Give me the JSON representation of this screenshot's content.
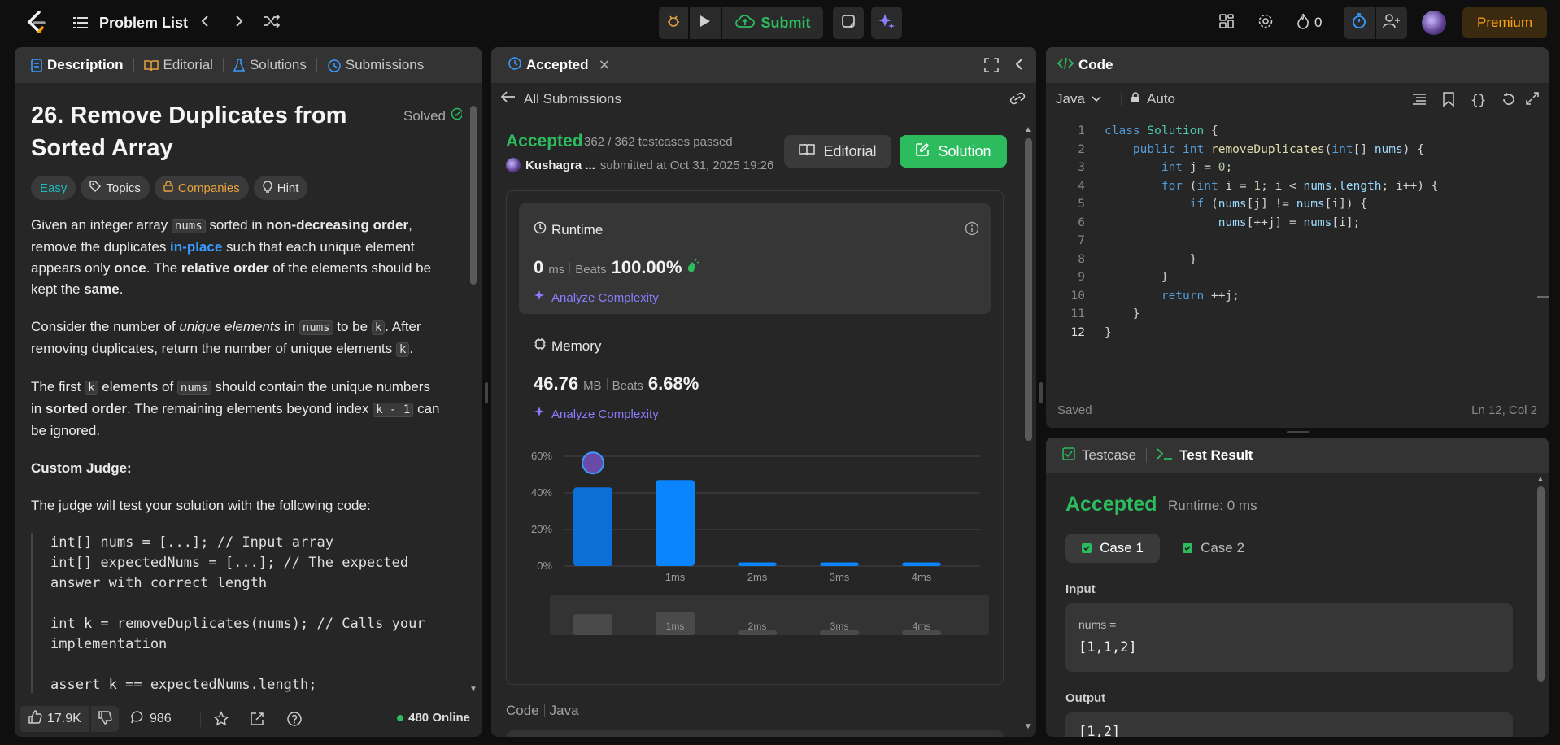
{
  "topbar": {
    "problem_list_label": "Problem List",
    "submit_label": "Submit",
    "streak_count": "0",
    "premium_label": "Premium"
  },
  "left": {
    "tabs": [
      "Description",
      "Editorial",
      "Solutions",
      "Submissions"
    ],
    "title_line1": "26. Remove Duplicates from",
    "title_line2": "Sorted Array",
    "solved_label": "Solved",
    "tags": {
      "difficulty": "Easy",
      "topics": "Topics",
      "companies": "Companies",
      "hint": "Hint"
    },
    "p1": {
      "a": "Given an integer array ",
      "code1": "nums",
      "b": " sorted in ",
      "bold1": "non-decreasing order",
      "c": ",",
      "d": "remove the duplicates ",
      "link": "in-place",
      "e": " such that each unique element",
      "f": "appears only ",
      "bold2": "once",
      "g": ". The ",
      "bold3": "relative order",
      "h": " of the elements should be",
      "i": "kept the ",
      "bold4": "same",
      "j": "."
    },
    "p2": {
      "a": "Consider the number of ",
      "em": "unique elements",
      "b": " in ",
      "code1": "nums",
      "c": " to be ",
      "code2": "k",
      "d": ". After",
      "e": "removing duplicates, return the number of unique elements ",
      "code3": "k",
      "f": "."
    },
    "p3": {
      "a": "The first ",
      "code1": "k",
      "b": " elements of ",
      "code2": "nums",
      "c": " should contain the unique numbers",
      "d": "in ",
      "bold1": "sorted order",
      "e": ". The remaining elements beyond index ",
      "code3": "k - 1",
      "f": " can",
      "g": "be ignored."
    },
    "custom_judge": "Custom Judge:",
    "judge_text": "The judge will test your solution with the following code:",
    "judge_code": [
      "int[] nums = [...]; // Input array",
      "int[] expectedNums = [...]; // The expected",
      "answer with correct length",
      "",
      "int k = removeDuplicates(nums); // Calls your",
      "implementation",
      "",
      "assert k == expectedNums.length;"
    ],
    "footer": {
      "likes": "17.9K",
      "comments": "986",
      "online": "480 Online"
    }
  },
  "middle": {
    "tab_label": "Accepted",
    "back_label": "All Submissions",
    "status": "Accepted",
    "testcases": "362 / 362 testcases passed",
    "user": "Kushagra ...",
    "submitted_at": "submitted at Oct 31, 2025 19:26",
    "editorial_label": "Editorial",
    "solution_label": "Solution",
    "runtime": {
      "label": "Runtime",
      "value": "0",
      "unit": "ms",
      "beats_label": "Beats",
      "beats": "100.00%",
      "analyze": "Analyze Complexity"
    },
    "memory": {
      "label": "Memory",
      "value": "46.76",
      "unit": "MB",
      "beats_label": "Beats",
      "beats": "6.68%",
      "analyze": "Analyze Complexity"
    },
    "code_label": "Code",
    "lang_label": "Java"
  },
  "chart_data": {
    "type": "bar",
    "yticks": [
      "60%",
      "40%",
      "20%",
      "0%"
    ],
    "ylim": [
      0,
      60
    ],
    "categories": [
      "",
      "1ms",
      "2ms",
      "3ms",
      "4ms"
    ],
    "values": [
      43,
      47,
      2,
      2,
      2
    ],
    "highlight_index": 0,
    "mini_labels": [
      "",
      "1ms",
      "2ms",
      "3ms",
      "4ms"
    ]
  },
  "editor": {
    "title": "Code",
    "language": "Java",
    "auto_label": "Auto",
    "lines": [
      "class Solution {",
      "    public int removeDuplicates(int[] nums) {",
      "        int j = 0;",
      "        for (int i = 1; i < nums.length; i++) {",
      "            if (nums[j] != nums[i]) {",
      "                nums[++j] = nums[i];",
      "",
      "            }",
      "        }",
      "        return ++j;",
      "    }",
      "}"
    ],
    "saved_label": "Saved",
    "cursor_pos": "Ln 12, Col 2"
  },
  "result": {
    "testcase_tab": "Testcase",
    "result_tab": "Test Result",
    "status": "Accepted",
    "runtime": "Runtime: 0 ms",
    "cases": [
      "Case 1",
      "Case 2"
    ],
    "input_label": "Input",
    "input_var": "nums =",
    "input_value": "[1,1,2]",
    "output_label": "Output",
    "output_value": "[1,2]"
  },
  "colors": {
    "accent_green": "#2cbb5d",
    "accent_blue": "#0a84ff",
    "premium": "#ffa116"
  }
}
